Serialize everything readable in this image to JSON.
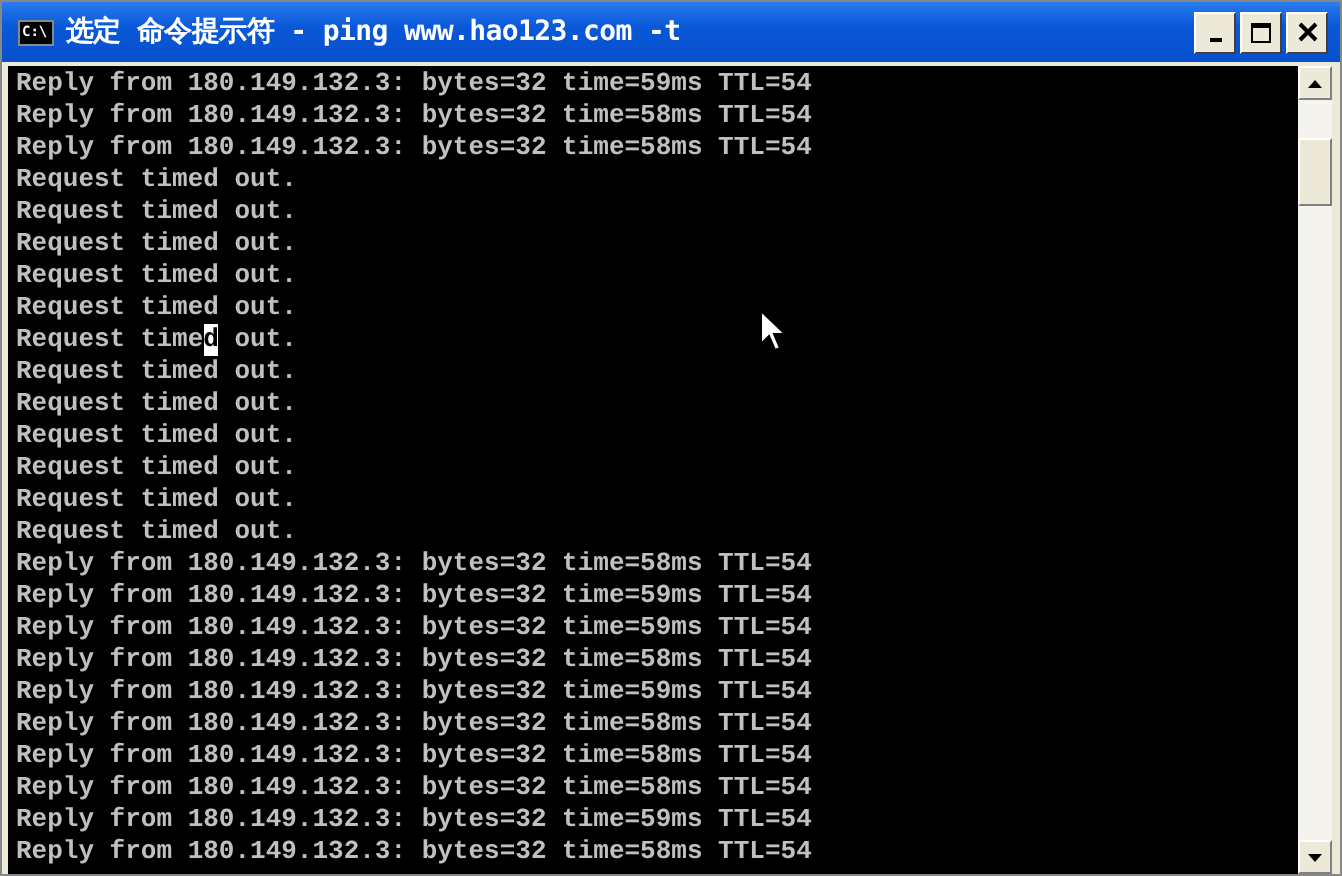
{
  "window": {
    "icon_text": "C:\\",
    "title": "选定 命令提示符 - ping www.hao123.com -t"
  },
  "console": {
    "lines": [
      {
        "kind": "plain",
        "text": "Reply from 180.149.132.3: bytes=32 time=59ms TTL=54"
      },
      {
        "kind": "plain",
        "text": "Reply from 180.149.132.3: bytes=32 time=58ms TTL=54"
      },
      {
        "kind": "plain",
        "text": "Reply from 180.149.132.3: bytes=32 time=58ms TTL=54"
      },
      {
        "kind": "plain",
        "text": "Request timed out."
      },
      {
        "kind": "plain",
        "text": "Request timed out."
      },
      {
        "kind": "plain",
        "text": "Request timed out."
      },
      {
        "kind": "plain",
        "text": "Request timed out."
      },
      {
        "kind": "plain",
        "text": "Request timed out."
      },
      {
        "kind": "selection",
        "before": "Request time",
        "selected": "d",
        "after": " out."
      },
      {
        "kind": "plain",
        "text": "Request timed out."
      },
      {
        "kind": "plain",
        "text": "Request timed out."
      },
      {
        "kind": "plain",
        "text": "Request timed out."
      },
      {
        "kind": "plain",
        "text": "Request timed out."
      },
      {
        "kind": "plain",
        "text": "Request timed out."
      },
      {
        "kind": "plain",
        "text": "Request timed out."
      },
      {
        "kind": "plain",
        "text": "Reply from 180.149.132.3: bytes=32 time=58ms TTL=54"
      },
      {
        "kind": "plain",
        "text": "Reply from 180.149.132.3: bytes=32 time=59ms TTL=54"
      },
      {
        "kind": "plain",
        "text": "Reply from 180.149.132.3: bytes=32 time=59ms TTL=54"
      },
      {
        "kind": "plain",
        "text": "Reply from 180.149.132.3: bytes=32 time=58ms TTL=54"
      },
      {
        "kind": "plain",
        "text": "Reply from 180.149.132.3: bytes=32 time=59ms TTL=54"
      },
      {
        "kind": "plain",
        "text": "Reply from 180.149.132.3: bytes=32 time=58ms TTL=54"
      },
      {
        "kind": "plain",
        "text": "Reply from 180.149.132.3: bytes=32 time=58ms TTL=54"
      },
      {
        "kind": "plain",
        "text": "Reply from 180.149.132.3: bytes=32 time=58ms TTL=54"
      },
      {
        "kind": "plain",
        "text": "Reply from 180.149.132.3: bytes=32 time=59ms TTL=54"
      },
      {
        "kind": "plain",
        "text": "Reply from 180.149.132.3: bytes=32 time=58ms TTL=54"
      }
    ]
  }
}
